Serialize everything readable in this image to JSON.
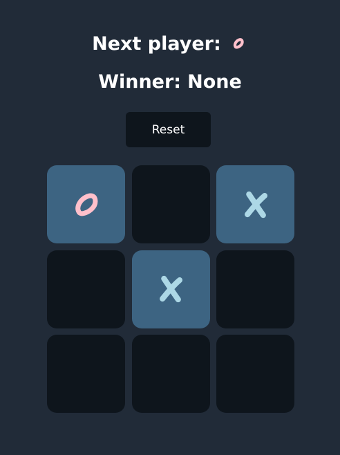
{
  "status": {
    "next_label": "Next player:",
    "next_player": "O",
    "winner_label": "Winner:",
    "winner_value": "None"
  },
  "reset_label": "Reset",
  "board": {
    "cells": [
      "O",
      "",
      "X",
      "",
      "X",
      "",
      "",
      "",
      ""
    ]
  },
  "colors": {
    "background": "#212b38",
    "cell_empty": "#0e151c",
    "cell_filled": "#3d6482",
    "o_mark": "#ffc0cb",
    "x_mark": "#add8e6",
    "reset_button": "#0e151c"
  }
}
